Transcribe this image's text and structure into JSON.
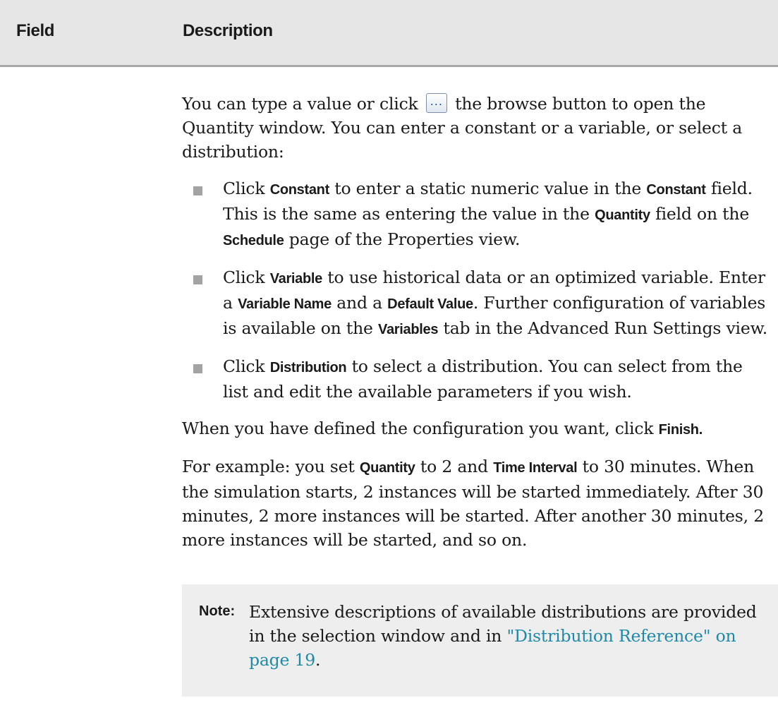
{
  "header": {
    "field": "Field",
    "description": "Description"
  },
  "intro": {
    "part1": "You can type a value or click ",
    "browse_button": "...",
    "part2": " the browse button to open the Quantity window. You can enter a constant or a variable, or select a distribution:"
  },
  "options": [
    {
      "t1": "Click ",
      "b1": "Constant",
      "t2": " to enter a static numeric value in the ",
      "b2": "Constant",
      "t3": " field. This is the same as entering the value in the ",
      "b3": "Quantity",
      "t4": " field on the ",
      "b4": "Schedule",
      "t5": " page of the Properties view."
    },
    {
      "t1": "Click ",
      "b1": "Variable",
      "t2": " to use historical data or an optimized variable. Enter a ",
      "b2": "Variable Name",
      "t3": " and a ",
      "b3": "Default Value",
      "t4": ". Further configuration of variables is available on the ",
      "b4": "Variables",
      "t5": " tab in the Advanced Run Settings view."
    },
    {
      "t1": "Click ",
      "b1": "Distribution",
      "t2": " to select a distribution. You can select from the list and edit the available parameters if you wish."
    }
  ],
  "finish": {
    "text": "When you have defined the configuration you want, click ",
    "bold": "Finish."
  },
  "example": {
    "t1": "For example: you set ",
    "b1": "Quantity",
    "t2": " to 2 and ",
    "b2": "Time Interval",
    "t3": " to 30 minutes. When the simulation starts, 2 instances will be started immediately. After 30 minutes, 2 more instances will be started. After another 30 minutes, 2 more instances will be started, and so on."
  },
  "note": {
    "label": "Note:",
    "text": "Extensive descriptions of available distributions are provided in the selection window and in ",
    "link": "\"Distribution Reference\" on page 19",
    "end": "."
  },
  "colors": {
    "header_bg": "#e6e6e6",
    "header_rule": "#a8a8a8",
    "note_bg": "#eeeeee",
    "link": "#1f8aa8",
    "bullet": "#a3a3a3"
  },
  "icons": {
    "bullet": "square-bullet-icon"
  }
}
